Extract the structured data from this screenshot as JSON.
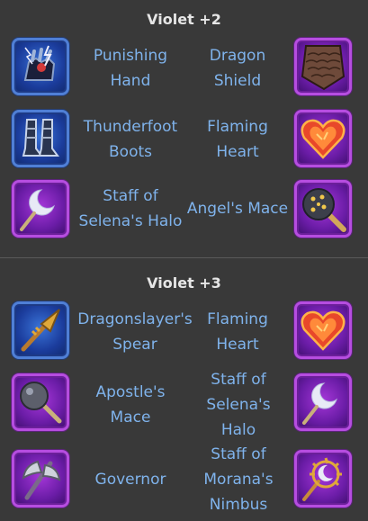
{
  "sections": [
    {
      "title": "Violet +2",
      "rows": [
        {
          "left_label": "Punishing\nHand",
          "right_label": "Dragon\nShield",
          "left_icon": "punishing-hand-icon",
          "right_icon": "dragon-shield-icon"
        },
        {
          "left_label": "Thunderfoot\nBoots",
          "right_label": "Flaming\nHeart",
          "left_icon": "thunderfoot-boots-icon",
          "right_icon": "flaming-heart-icon"
        },
        {
          "left_label": "Staff of\nSelena's Halo",
          "right_label": "Angel's Mace",
          "left_icon": "staff-of-selenas-halo-icon",
          "right_icon": "angels-mace-icon"
        }
      ]
    },
    {
      "title": "Violet +3",
      "rows": [
        {
          "left_label": "Dragonslayer's\nSpear",
          "right_label": "Flaming\nHeart",
          "left_icon": "dragonslayers-spear-icon",
          "right_icon": "flaming-heart-icon"
        },
        {
          "left_label": "Apostle's\nMace",
          "right_label": "Staff of\nSelena's\nHalo",
          "left_icon": "apostles-mace-icon",
          "right_icon": "staff-of-selenas-halo-icon"
        },
        {
          "left_label": "Governor",
          "right_label": "Staff of\nMorana's\nNimbus",
          "left_icon": "governor-icon",
          "right_icon": "staff-of-moranas-nimbus-icon"
        }
      ]
    }
  ],
  "colors": {
    "background": "#393939",
    "title": "#e6e6e6",
    "label": "#7fb3ec",
    "blue_frame": "#4f7fd6",
    "purple_frame": "#b64de0"
  }
}
